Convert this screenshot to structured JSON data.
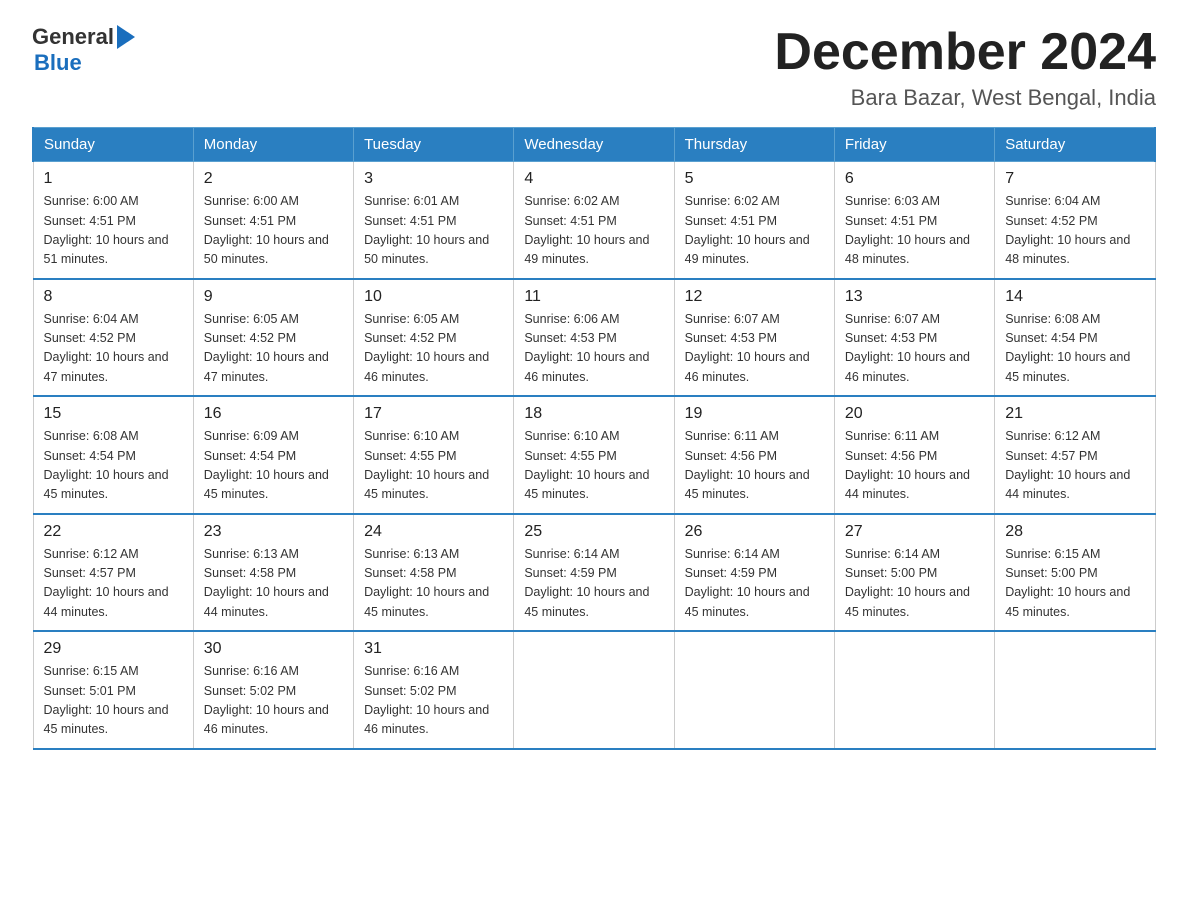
{
  "header": {
    "logo_general": "General",
    "logo_blue": "Blue",
    "month_year": "December 2024",
    "location": "Bara Bazar, West Bengal, India"
  },
  "weekdays": [
    "Sunday",
    "Monday",
    "Tuesday",
    "Wednesday",
    "Thursday",
    "Friday",
    "Saturday"
  ],
  "weeks": [
    [
      {
        "day": "1",
        "sunrise": "6:00 AM",
        "sunset": "4:51 PM",
        "daylight": "10 hours and 51 minutes."
      },
      {
        "day": "2",
        "sunrise": "6:00 AM",
        "sunset": "4:51 PM",
        "daylight": "10 hours and 50 minutes."
      },
      {
        "day": "3",
        "sunrise": "6:01 AM",
        "sunset": "4:51 PM",
        "daylight": "10 hours and 50 minutes."
      },
      {
        "day": "4",
        "sunrise": "6:02 AM",
        "sunset": "4:51 PM",
        "daylight": "10 hours and 49 minutes."
      },
      {
        "day": "5",
        "sunrise": "6:02 AM",
        "sunset": "4:51 PM",
        "daylight": "10 hours and 49 minutes."
      },
      {
        "day": "6",
        "sunrise": "6:03 AM",
        "sunset": "4:51 PM",
        "daylight": "10 hours and 48 minutes."
      },
      {
        "day": "7",
        "sunrise": "6:04 AM",
        "sunset": "4:52 PM",
        "daylight": "10 hours and 48 minutes."
      }
    ],
    [
      {
        "day": "8",
        "sunrise": "6:04 AM",
        "sunset": "4:52 PM",
        "daylight": "10 hours and 47 minutes."
      },
      {
        "day": "9",
        "sunrise": "6:05 AM",
        "sunset": "4:52 PM",
        "daylight": "10 hours and 47 minutes."
      },
      {
        "day": "10",
        "sunrise": "6:05 AM",
        "sunset": "4:52 PM",
        "daylight": "10 hours and 46 minutes."
      },
      {
        "day": "11",
        "sunrise": "6:06 AM",
        "sunset": "4:53 PM",
        "daylight": "10 hours and 46 minutes."
      },
      {
        "day": "12",
        "sunrise": "6:07 AM",
        "sunset": "4:53 PM",
        "daylight": "10 hours and 46 minutes."
      },
      {
        "day": "13",
        "sunrise": "6:07 AM",
        "sunset": "4:53 PM",
        "daylight": "10 hours and 46 minutes."
      },
      {
        "day": "14",
        "sunrise": "6:08 AM",
        "sunset": "4:54 PM",
        "daylight": "10 hours and 45 minutes."
      }
    ],
    [
      {
        "day": "15",
        "sunrise": "6:08 AM",
        "sunset": "4:54 PM",
        "daylight": "10 hours and 45 minutes."
      },
      {
        "day": "16",
        "sunrise": "6:09 AM",
        "sunset": "4:54 PM",
        "daylight": "10 hours and 45 minutes."
      },
      {
        "day": "17",
        "sunrise": "6:10 AM",
        "sunset": "4:55 PM",
        "daylight": "10 hours and 45 minutes."
      },
      {
        "day": "18",
        "sunrise": "6:10 AM",
        "sunset": "4:55 PM",
        "daylight": "10 hours and 45 minutes."
      },
      {
        "day": "19",
        "sunrise": "6:11 AM",
        "sunset": "4:56 PM",
        "daylight": "10 hours and 45 minutes."
      },
      {
        "day": "20",
        "sunrise": "6:11 AM",
        "sunset": "4:56 PM",
        "daylight": "10 hours and 44 minutes."
      },
      {
        "day": "21",
        "sunrise": "6:12 AM",
        "sunset": "4:57 PM",
        "daylight": "10 hours and 44 minutes."
      }
    ],
    [
      {
        "day": "22",
        "sunrise": "6:12 AM",
        "sunset": "4:57 PM",
        "daylight": "10 hours and 44 minutes."
      },
      {
        "day": "23",
        "sunrise": "6:13 AM",
        "sunset": "4:58 PM",
        "daylight": "10 hours and 44 minutes."
      },
      {
        "day": "24",
        "sunrise": "6:13 AM",
        "sunset": "4:58 PM",
        "daylight": "10 hours and 45 minutes."
      },
      {
        "day": "25",
        "sunrise": "6:14 AM",
        "sunset": "4:59 PM",
        "daylight": "10 hours and 45 minutes."
      },
      {
        "day": "26",
        "sunrise": "6:14 AM",
        "sunset": "4:59 PM",
        "daylight": "10 hours and 45 minutes."
      },
      {
        "day": "27",
        "sunrise": "6:14 AM",
        "sunset": "5:00 PM",
        "daylight": "10 hours and 45 minutes."
      },
      {
        "day": "28",
        "sunrise": "6:15 AM",
        "sunset": "5:00 PM",
        "daylight": "10 hours and 45 minutes."
      }
    ],
    [
      {
        "day": "29",
        "sunrise": "6:15 AM",
        "sunset": "5:01 PM",
        "daylight": "10 hours and 45 minutes."
      },
      {
        "day": "30",
        "sunrise": "6:16 AM",
        "sunset": "5:02 PM",
        "daylight": "10 hours and 46 minutes."
      },
      {
        "day": "31",
        "sunrise": "6:16 AM",
        "sunset": "5:02 PM",
        "daylight": "10 hours and 46 minutes."
      },
      null,
      null,
      null,
      null
    ]
  ],
  "labels": {
    "sunrise": "Sunrise:",
    "sunset": "Sunset:",
    "daylight": "Daylight:"
  }
}
